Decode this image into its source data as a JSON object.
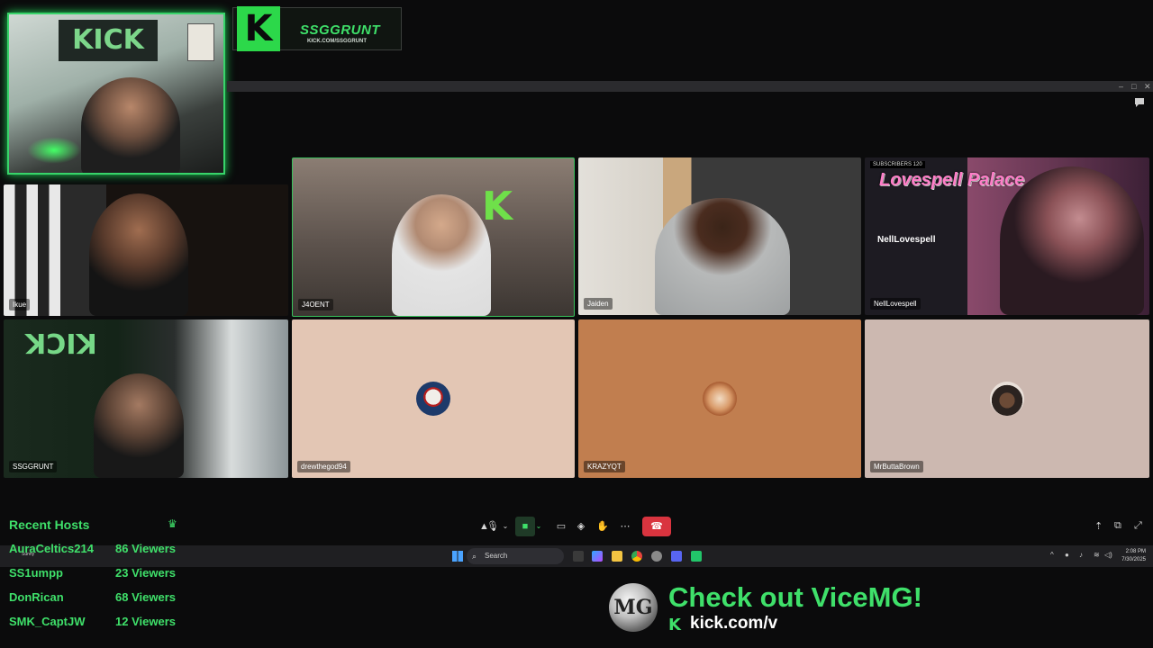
{
  "banner": {
    "channel": "SSGGRUNT",
    "url": "KICK.COM/SSGGRUNT",
    "facecam_sign": "KICK"
  },
  "participants": [
    {
      "name": "Ikue"
    },
    {
      "name": "J4OENT"
    },
    {
      "name": "Jaiden"
    },
    {
      "name": "NellLovespell",
      "overlay_brand": "Lovespell Palace",
      "overlay_tiktok": "NellLovespell",
      "overlay_subs": "SUBSCRIBERS 120"
    },
    {
      "name": "SSGGRUNT"
    },
    {
      "name": "drewthegod94"
    },
    {
      "name": "KRAZYQT"
    },
    {
      "name": "MrButtaBrown"
    }
  ],
  "meeting_controls": {
    "icons": [
      "microphone-icon",
      "chevron-down-icon",
      "camera-icon",
      "chevron-down-icon",
      "share-screen-icon",
      "gamepad-icon",
      "raise-hand-icon",
      "more-icon",
      "leave-call-icon"
    ],
    "right_icons": [
      "pin-icon",
      "popout-icon",
      "fullscreen-icon"
    ],
    "accent_leave": "#d9343f"
  },
  "taskbar": {
    "search_placeholder": "Search",
    "weather": "Sunny",
    "time": "2:08 PM",
    "date": "7/30/2025"
  },
  "recent_hosts": {
    "title": "Recent Hosts",
    "items": [
      {
        "name": "AuraCeltics214",
        "viewers": "86 Viewers"
      },
      {
        "name": "SS1umpp",
        "viewers": "23 Viewers"
      },
      {
        "name": "DonRican",
        "viewers": "68 Viewers"
      },
      {
        "name": "SMK_CaptJW",
        "viewers": "12 Viewers"
      }
    ]
  },
  "promo": {
    "logo_text": "MG",
    "title": "Check out ViceMG!",
    "k_glyph": "K",
    "url": "kick.com/v"
  },
  "colors": {
    "accent_green": "#3fe06a",
    "background": "#0b0b0c"
  }
}
